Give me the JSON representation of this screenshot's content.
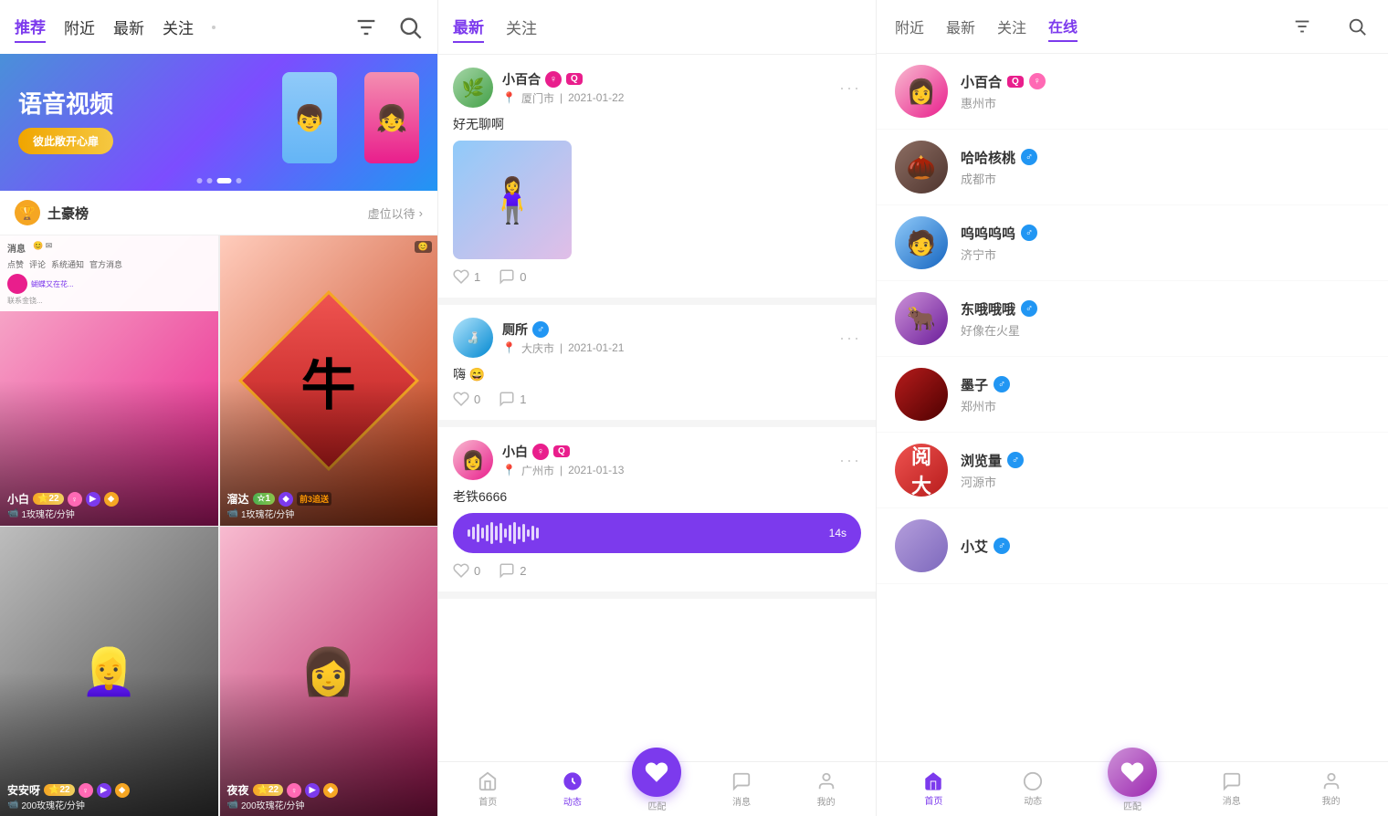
{
  "left": {
    "nav": {
      "items": [
        "推荐",
        "附近",
        "最新",
        "关注"
      ],
      "active": "推荐",
      "filter_label": "filter",
      "search_label": "search"
    },
    "banner": {
      "title": "语音视频",
      "subtitle": "彼此敞开心扉",
      "dots": [
        0,
        1,
        2,
        3
      ],
      "active_dot": 2
    },
    "leaderboard": {
      "title": "土豪榜",
      "placeholder": "虚位以待",
      "arrow": "›"
    },
    "videos": [
      {
        "name": "小白",
        "level": "22",
        "price": "1玫瑰花/分钟",
        "type": "video",
        "color": "pink"
      },
      {
        "name": "溜达",
        "level": "1",
        "price": "1玫瑰花/分钟",
        "type": "video",
        "color": "red"
      },
      {
        "name": "安安呀",
        "level": "22",
        "price": "200玫瑰花/分钟",
        "type": "video",
        "color": "gray"
      },
      {
        "name": "夜夜",
        "level": "22",
        "price": "200玫瑰花/分钟",
        "type": "video",
        "color": "light"
      }
    ]
  },
  "middle": {
    "nav": {
      "items": [
        "最新",
        "关注"
      ],
      "active": "最新"
    },
    "feeds": [
      {
        "username": "小百合?",
        "location": "厦门市",
        "date": "2021-01-22",
        "text": "好无聊啊",
        "has_image": true,
        "likes": "1",
        "comments": "0",
        "gender": "female"
      },
      {
        "username": "厕所",
        "location": "大庆市",
        "date": "2021-01-21",
        "text": "嗨😄",
        "has_image": false,
        "likes": "0",
        "comments": "1",
        "gender": "male"
      },
      {
        "username": "小白",
        "location": "广州市",
        "date": "2021-01-13",
        "text": "老铁6666",
        "has_audio": true,
        "audio_duration": "14s",
        "likes": "0",
        "comments": "2",
        "gender": "female"
      }
    ],
    "bottom_nav": {
      "items": [
        "首页",
        "动态",
        "匹配",
        "消息",
        "我的"
      ],
      "active": "动态"
    }
  },
  "right": {
    "nav": {
      "items": [
        "附近",
        "最新",
        "关注",
        "在线"
      ],
      "active": "在线",
      "filter_label": "filter",
      "search_label": "search"
    },
    "online_users": [
      {
        "name": "小百合",
        "location": "惠州市",
        "gender": "female",
        "color": "pink"
      },
      {
        "name": "哈哈核桃",
        "location": "成都市",
        "gender": "male",
        "color": "brown"
      },
      {
        "name": "呜呜呜呜",
        "location": "济宁市",
        "gender": "male",
        "color": "blue"
      },
      {
        "name": "东哦哦哦",
        "location": "好像在火星",
        "gender": "male",
        "color": "purple"
      },
      {
        "name": "墨子",
        "location": "郑州市",
        "gender": "male",
        "color": "dark"
      },
      {
        "name": "浏览量",
        "location": "河源市",
        "gender": "male",
        "color": "red"
      },
      {
        "name": "小艾",
        "location": "",
        "gender": "male",
        "color": "purple2"
      }
    ],
    "bottom_nav": {
      "items": [
        "首页",
        "动态",
        "匹配",
        "消息",
        "我的"
      ],
      "active": "首页"
    }
  },
  "icons": {
    "filter": "⊟",
    "search": "⌕",
    "trophy": "🏆",
    "heart": "♡",
    "comment": "○",
    "location_pin": "📍",
    "video_camera": "📹",
    "rose": "🌹"
  }
}
